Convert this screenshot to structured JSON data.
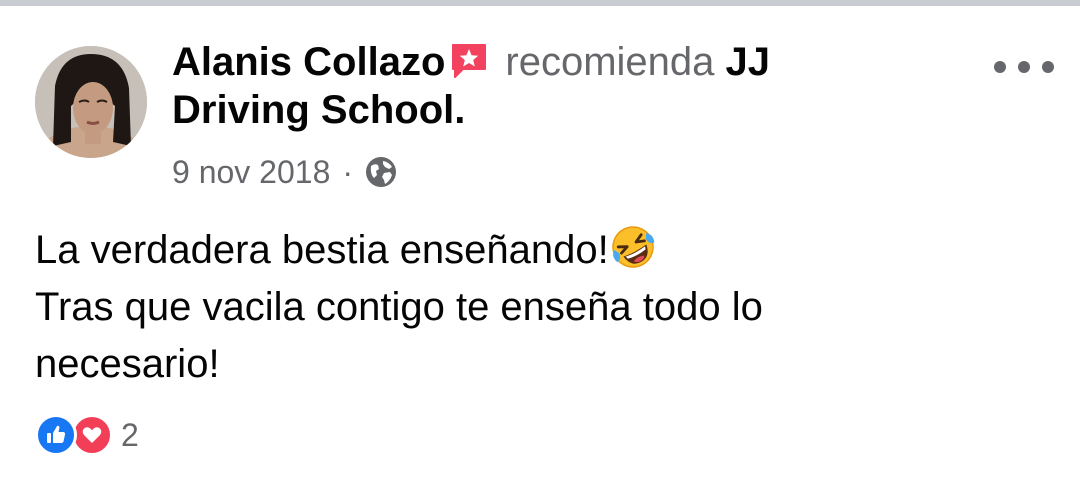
{
  "post": {
    "author": "Alanis Collazo",
    "action": "recomienda",
    "page": "JJ Driving School.",
    "date": "9 nov 2018",
    "separator": "·",
    "privacy_icon": "globe-icon",
    "more_icon": "more-options-icon",
    "text_lines": [
      "La verdadera bestia enseñando!",
      "Tras que vacila contigo te enseña todo lo",
      "necesario!"
    ],
    "emoji": "rolling-on-floor-laughing-emoji",
    "reactions": {
      "types": [
        "like",
        "love"
      ],
      "count": "2"
    }
  },
  "colors": {
    "secondary_text": "#65676b",
    "like_blue": "#1877f2",
    "love_red": "#f33e58",
    "recommend_badge": "#f3425f",
    "divider": "#c9ccd1"
  }
}
